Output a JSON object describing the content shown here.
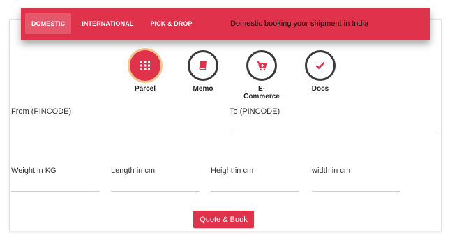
{
  "topbar": {
    "tabs": [
      {
        "label": "DOMESTIC",
        "active": true
      },
      {
        "label": "INTERNATIONAL",
        "active": false
      },
      {
        "label": "PICK & DROP",
        "active": false
      }
    ],
    "title": "Domestic booking your shipment in India"
  },
  "shipment_types": [
    {
      "label": "Parcel",
      "icon": "grid-icon",
      "active": true
    },
    {
      "label": "Memo",
      "icon": "book-icon",
      "active": false
    },
    {
      "label": "E-Commerce",
      "icon": "cart-icon",
      "active": false
    },
    {
      "label": "Docs",
      "icon": "check-icon",
      "active": false
    }
  ],
  "form": {
    "from_label": "From (PINCODE)",
    "to_label": "To (PINCODE)",
    "weight_label": "Weight in KG",
    "length_label": "Length in cm",
    "height_label": "Height in cm",
    "width_label": "width in cm",
    "from_value": "",
    "to_value": "",
    "weight_value": "",
    "length_value": "",
    "height_value": "",
    "width_value": ""
  },
  "actions": {
    "quote_label": "Quote & Book"
  },
  "colors": {
    "accent": "#e0324a",
    "active_ring": "#f6c48f",
    "icon_dark": "#3a3a3a"
  }
}
